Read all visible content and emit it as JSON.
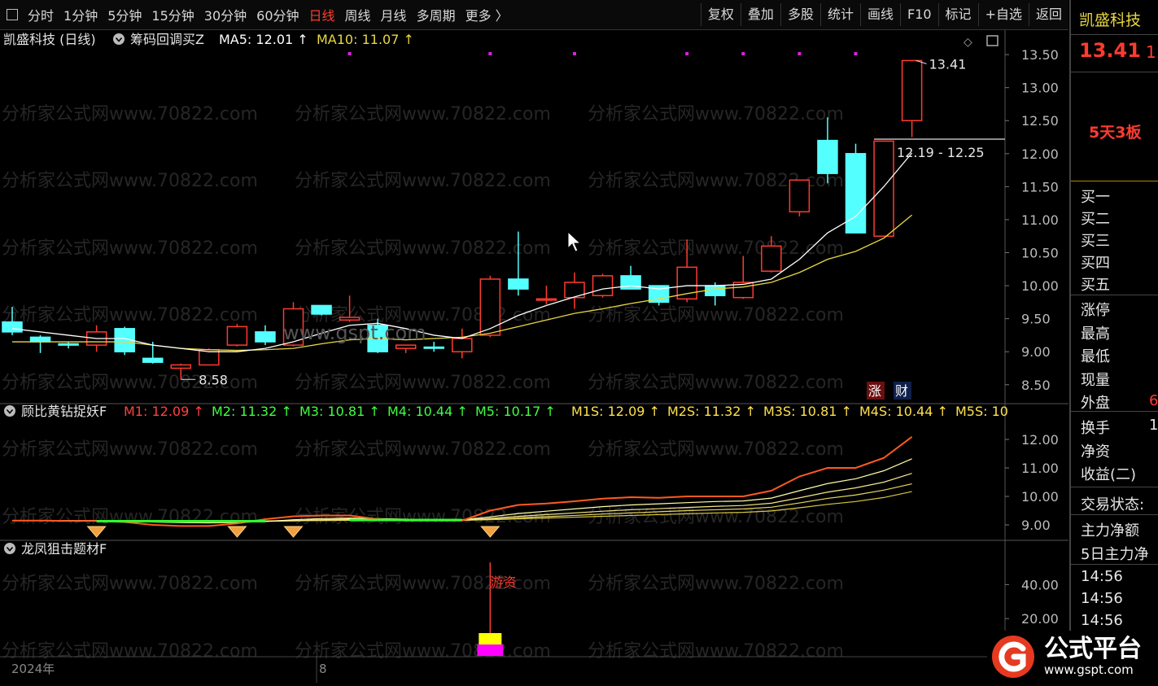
{
  "toolbar": {
    "items": [
      "分时",
      "1分钟",
      "5分钟",
      "15分钟",
      "30分钟",
      "60分钟",
      "日线",
      "周线",
      "月线",
      "多周期",
      "更多 〉"
    ],
    "active": "日线",
    "right": [
      "复权",
      "叠加",
      "多股",
      "统计",
      "画线",
      "F10",
      "标记",
      "+自选",
      "返回"
    ]
  },
  "main_header": {
    "title": "凯盛科技 (日线)",
    "indicator": "筹码回调买Z",
    "ma5": "MA5: 12.01",
    "ma10": "MA10: 11.07"
  },
  "sub1_header": {
    "indicator": "顾比黄钻捉妖F",
    "items": [
      {
        "label": "M1: 12.09",
        "color": "#ff4040"
      },
      {
        "label": "M2: 11.32",
        "color": "#40ff40"
      },
      {
        "label": "M3: 10.81",
        "color": "#40ff40"
      },
      {
        "label": "M4: 10.44",
        "color": "#40ff40"
      },
      {
        "label": "M5: 10.17",
        "color": "#40ff40"
      },
      {
        "label": "M1S: 12.09",
        "color": "#ffe14d"
      },
      {
        "label": "M2S: 11.32",
        "color": "#ffe14d"
      },
      {
        "label": "M3S: 10.81",
        "color": "#ffe14d"
      },
      {
        "label": "M4S: 10.44",
        "color": "#ffe14d"
      },
      {
        "label": "M5S: 10",
        "color": "#ffe14d"
      }
    ]
  },
  "sub2_header": {
    "indicator": "龙凤狙击题材F",
    "marker_label": "游资"
  },
  "annotations": {
    "high_label": "13.41",
    "low_label": "8.58",
    "range_label": "12.19 - 12.25",
    "zhang": "涨",
    "cai": "财",
    "watermark": "分析家公式网www.70822.com",
    "center_watermark": "www.gspt.com",
    "date_left": "2024年",
    "date_mid": "8"
  },
  "right_panel": {
    "name": "凯盛科技",
    "price": "13.41",
    "price_suffix": "1",
    "board": "5天3板",
    "buy": [
      "买一",
      "买二",
      "买三",
      "买四",
      "买五"
    ],
    "stats": [
      "涨停",
      "最高",
      "最低",
      "现量",
      "外盘"
    ],
    "waipan_val": "6",
    "stats2": [
      "换手",
      "净资",
      "收益(二)"
    ],
    "huanshou_val": "1",
    "trade_state": "交易状态:",
    "main_net": "主力净额",
    "main_net5": "5日主力净",
    "times": [
      "14:56",
      "14:56",
      "14:56"
    ]
  },
  "logo": {
    "text": "公式平台",
    "url": "www.gspt.com"
  },
  "colors": {
    "up": "#ff3b30",
    "down": "#54ffff",
    "ma5": "#ffffff",
    "ma10": "#e8d840"
  },
  "chart_data": [
    {
      "type": "candlestick",
      "title": "凯盛科技 (日线)",
      "ylim": [
        8.3,
        13.6
      ],
      "yticks": [
        8.5,
        9.0,
        9.5,
        10.0,
        10.5,
        11.0,
        11.5,
        12.0,
        12.5,
        13.0,
        13.5
      ],
      "candles": [
        {
          "o": 9.45,
          "h": 9.68,
          "l": 9.25,
          "c": 9.3
        },
        {
          "o": 9.22,
          "h": 9.25,
          "l": 8.98,
          "c": 9.15
        },
        {
          "o": 9.12,
          "h": 9.15,
          "l": 9.05,
          "c": 9.1
        },
        {
          "o": 9.1,
          "h": 9.4,
          "l": 9.0,
          "c": 9.3
        },
        {
          "o": 9.35,
          "h": 9.38,
          "l": 8.95,
          "c": 9.0
        },
        {
          "o": 8.9,
          "h": 9.15,
          "l": 8.82,
          "c": 8.84
        },
        {
          "o": 8.75,
          "h": 8.82,
          "l": 8.58,
          "c": 8.8
        },
        {
          "o": 8.8,
          "h": 9.05,
          "l": 8.8,
          "c": 9.03
        },
        {
          "o": 9.1,
          "h": 9.42,
          "l": 9.08,
          "c": 9.38
        },
        {
          "o": 9.3,
          "h": 9.4,
          "l": 9.1,
          "c": 9.15
        },
        {
          "o": 9.1,
          "h": 9.75,
          "l": 9.08,
          "c": 9.65
        },
        {
          "o": 9.7,
          "h": 9.7,
          "l": 9.55,
          "c": 9.57
        },
        {
          "o": 9.48,
          "h": 9.85,
          "l": 9.45,
          "c": 9.52
        },
        {
          "o": 9.4,
          "h": 9.5,
          "l": 8.98,
          "c": 9.0
        },
        {
          "o": 9.05,
          "h": 9.1,
          "l": 8.98,
          "c": 9.1
        },
        {
          "o": 9.07,
          "h": 9.15,
          "l": 9.0,
          "c": 9.06
        },
        {
          "o": 9.0,
          "h": 9.35,
          "l": 8.9,
          "c": 9.2
        },
        {
          "o": 9.25,
          "h": 10.15,
          "l": 9.22,
          "c": 10.1
        },
        {
          "o": 10.1,
          "h": 10.82,
          "l": 9.85,
          "c": 9.95
        },
        {
          "o": 9.78,
          "h": 10.0,
          "l": 9.72,
          "c": 9.8
        },
        {
          "o": 9.82,
          "h": 10.2,
          "l": 9.65,
          "c": 10.05
        },
        {
          "o": 9.85,
          "h": 10.18,
          "l": 9.82,
          "c": 10.15
        },
        {
          "o": 10.15,
          "h": 10.3,
          "l": 9.95,
          "c": 9.95
        },
        {
          "o": 10.0,
          "h": 10.0,
          "l": 9.7,
          "c": 9.75
        },
        {
          "o": 9.8,
          "h": 10.7,
          "l": 9.75,
          "c": 10.28
        },
        {
          "o": 10.0,
          "h": 10.05,
          "l": 9.7,
          "c": 9.85
        },
        {
          "o": 9.82,
          "h": 10.45,
          "l": 9.8,
          "c": 10.05
        },
        {
          "o": 10.22,
          "h": 10.75,
          "l": 10.2,
          "c": 10.6
        },
        {
          "o": 11.12,
          "h": 11.6,
          "l": 11.05,
          "c": 11.6
        },
        {
          "o": 12.2,
          "h": 12.55,
          "l": 11.55,
          "c": 11.7
        },
        {
          "o": 12.0,
          "h": 12.15,
          "l": 10.85,
          "c": 10.8
        },
        {
          "o": 10.75,
          "h": 12.19,
          "l": 10.75,
          "c": 12.19
        },
        {
          "o": 12.5,
          "h": 13.41,
          "l": 12.25,
          "c": 13.41
        }
      ],
      "ma5": [
        9.35,
        9.3,
        9.25,
        9.2,
        9.2,
        9.1,
        9.05,
        9.0,
        9.0,
        9.05,
        9.15,
        9.28,
        9.4,
        9.43,
        9.35,
        9.25,
        9.2,
        9.35,
        9.55,
        9.7,
        9.83,
        9.95,
        10.0,
        9.95,
        10.0,
        10.0,
        10.02,
        10.1,
        10.4,
        10.8,
        11.05,
        11.5,
        12.01
      ],
      "ma10": [
        9.15,
        9.15,
        9.15,
        9.15,
        9.15,
        9.1,
        9.05,
        9.03,
        9.02,
        9.03,
        9.05,
        9.12,
        9.18,
        9.2,
        9.18,
        9.2,
        9.22,
        9.28,
        9.38,
        9.48,
        9.58,
        9.65,
        9.73,
        9.8,
        9.88,
        9.95,
        9.98,
        10.05,
        10.2,
        10.4,
        10.52,
        10.72,
        11.07
      ]
    },
    {
      "type": "line",
      "title": "顾比黄钻捉妖F",
      "ylim": [
        8.6,
        12.6
      ],
      "yticks": [
        9.0,
        10.0,
        11.0,
        12.0
      ],
      "series": [
        {
          "name": "M1",
          "values": [
            9.15,
            9.15,
            9.14,
            9.14,
            9.1,
            9.0,
            8.96,
            8.96,
            9.05,
            9.2,
            9.3,
            9.33,
            9.33,
            9.2,
            9.15,
            9.15,
            9.15,
            9.5,
            9.7,
            9.75,
            9.83,
            9.92,
            9.97,
            9.95,
            10.0,
            10.0,
            10.0,
            10.2,
            10.7,
            11.0,
            11.0,
            11.35,
            12.09
          ]
        },
        {
          "name": "M2",
          "values": [
            9.15,
            9.15,
            9.15,
            9.15,
            9.13,
            9.1,
            9.08,
            9.07,
            9.08,
            9.12,
            9.18,
            9.22,
            9.24,
            9.22,
            9.2,
            9.18,
            9.18,
            9.28,
            9.4,
            9.48,
            9.56,
            9.64,
            9.7,
            9.74,
            9.78,
            9.82,
            9.84,
            9.94,
            10.2,
            10.45,
            10.62,
            10.9,
            11.32
          ]
        },
        {
          "name": "M3",
          "values": [
            9.15,
            9.15,
            9.15,
            9.15,
            9.14,
            9.12,
            9.11,
            9.1,
            9.1,
            9.12,
            9.15,
            9.18,
            9.2,
            9.19,
            9.18,
            9.17,
            9.17,
            9.23,
            9.3,
            9.36,
            9.42,
            9.48,
            9.53,
            9.57,
            9.61,
            9.65,
            9.68,
            9.76,
            9.95,
            10.15,
            10.3,
            10.5,
            10.81
          ]
        },
        {
          "name": "M4",
          "values": [
            9.15,
            9.15,
            9.15,
            9.15,
            9.15,
            9.14,
            9.13,
            9.12,
            9.12,
            9.13,
            9.14,
            9.16,
            9.17,
            9.17,
            9.17,
            9.16,
            9.16,
            9.2,
            9.25,
            9.29,
            9.33,
            9.38,
            9.42,
            9.46,
            9.5,
            9.53,
            9.56,
            9.62,
            9.77,
            9.93,
            10.05,
            10.22,
            10.44
          ]
        },
        {
          "name": "M5",
          "values": [
            9.15,
            9.15,
            9.15,
            9.15,
            9.15,
            9.15,
            9.14,
            9.14,
            9.14,
            9.14,
            9.15,
            9.15,
            9.16,
            9.16,
            9.16,
            9.16,
            9.16,
            9.18,
            9.21,
            9.24,
            9.27,
            9.3,
            9.33,
            9.36,
            9.39,
            9.42,
            9.44,
            9.49,
            9.6,
            9.72,
            9.82,
            9.96,
            10.17
          ]
        }
      ],
      "diamonds_at": [
        3,
        8,
        10,
        17
      ]
    },
    {
      "type": "bar",
      "title": "龙凤狙击题材F",
      "ylim": [
        0,
        55
      ],
      "yticks": [
        20.0,
        40.0
      ],
      "spike_index": 17,
      "spike_value": 53
    }
  ]
}
